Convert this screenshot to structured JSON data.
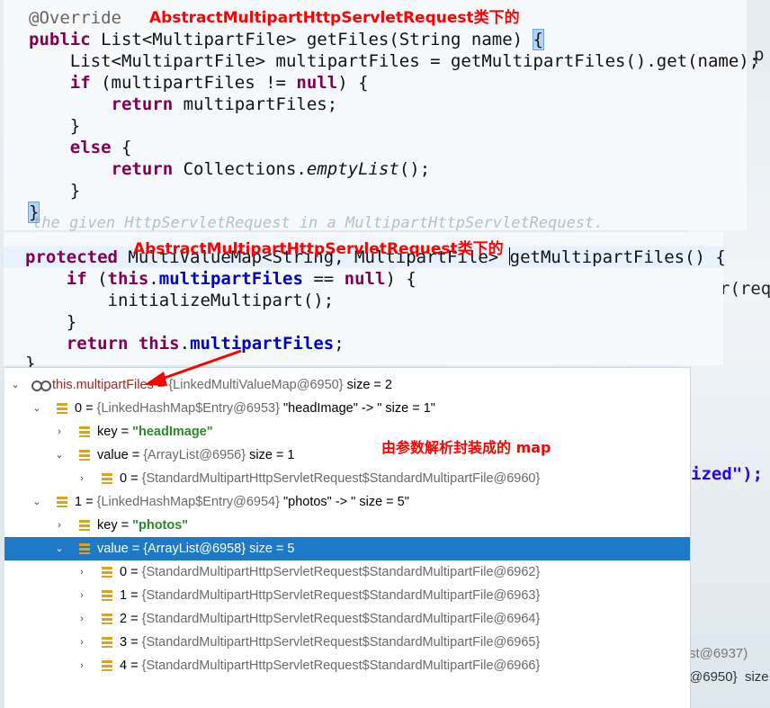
{
  "colors": {
    "annotation_red": "#ff0000",
    "selection_blue": "#1e7ac6",
    "keyword": "#7f0055",
    "field": "#0000c0",
    "string_green": "#2a8a2a"
  },
  "panel1": {
    "title": "AbstractMultipartHttpServletRequest类下的",
    "lines": {
      "l1": "@Override",
      "l2a": "public",
      "l2b": " List<MultipartFile> getFiles(String name) ",
      "l2c": "{",
      "l3": "    List<MultipartFile> multipartFiles = getMultipartFiles().get(name);",
      "l4a": "    if",
      "l4b": " (multipartFiles != ",
      "l4c": "null",
      "l4d": ") {",
      "l5a": "        return",
      "l5b": " multipartFiles;",
      "l6": "    }",
      "l7a": "    else",
      "l7b": " {",
      "l8a": "        return",
      "l8b": " Collections.",
      "l8c": "emptyList",
      "l8d": "();",
      "l9": "    }",
      "l10": "}"
    }
  },
  "ghost_text": "the given HttpServletRequest in a MultipartHttpServletRequest.",
  "panel2": {
    "title": "AbstractMultipartHttpServletRequest类下的",
    "lines": {
      "l1a": "protected",
      "l1b": " MultiValueMap<String, MultipartFile> ",
      "l1c": "getMultipartFiles() {",
      "l2a": "    if",
      "l2b": " (",
      "l2c": "this",
      "l2d": ".",
      "l2e": "multipartFiles",
      "l2f": " == ",
      "l2g": "null",
      "l2h": ") {",
      "l3": "        initializeMultipart();",
      "l4": "    }",
      "l5a": "    return",
      "l5b": " ",
      "l5c": "this",
      "l5d": ".",
      "l5e": "multipartFiles",
      "l5f": ";",
      "l6": "}"
    }
  },
  "background_fragments": {
    "f1": "p",
    "f2": "r(req",
    "f3": "ized\");",
    "f4": "st@6937)",
    "f5": "@6950}  size"
  },
  "annotation": "由参数解析封装成的 map",
  "tree": {
    "rows": [
      {
        "name": "this.multipartFiles",
        "eq": " = ",
        "ref": "{LinkedMultiValueMap@6950}",
        "rest": "  size = 2"
      },
      {
        "name": "0",
        "eq": " = ",
        "ref": "{LinkedHashMap$Entry@6953}",
        "rest": " \"headImage\" -> \" size = 1\""
      },
      {
        "name": "key",
        "eq": " = ",
        "ref": "",
        "rest": "\"headImage\""
      },
      {
        "name": "value",
        "eq": " = ",
        "ref": "{ArrayList@6956}",
        "rest": "  size = 1"
      },
      {
        "name": "0",
        "eq": " = ",
        "ref": "{StandardMultipartHttpServletRequest$StandardMultipartFile@6960}",
        "rest": ""
      },
      {
        "name": "1",
        "eq": " = ",
        "ref": "{LinkedHashMap$Entry@6954}",
        "rest": " \"photos\" -> \" size = 5\""
      },
      {
        "name": "key",
        "eq": " = ",
        "ref": "",
        "rest": "\"photos\""
      },
      {
        "name": "value",
        "eq": " = ",
        "ref": "{ArrayList@6958}",
        "rest": "  size = 5"
      },
      {
        "name": "0",
        "eq": " = ",
        "ref": "{StandardMultipartHttpServletRequest$StandardMultipartFile@6962}",
        "rest": ""
      },
      {
        "name": "1",
        "eq": " = ",
        "ref": "{StandardMultipartHttpServletRequest$StandardMultipartFile@6963}",
        "rest": ""
      },
      {
        "name": "2",
        "eq": " = ",
        "ref": "{StandardMultipartHttpServletRequest$StandardMultipartFile@6964}",
        "rest": ""
      },
      {
        "name": "3",
        "eq": " = ",
        "ref": "{StandardMultipartHttpServletRequest$StandardMultipartFile@6965}",
        "rest": ""
      },
      {
        "name": "4",
        "eq": " = ",
        "ref": "{StandardMultipartHttpServletRequest$StandardMultipartFile@6966}",
        "rest": ""
      }
    ]
  }
}
